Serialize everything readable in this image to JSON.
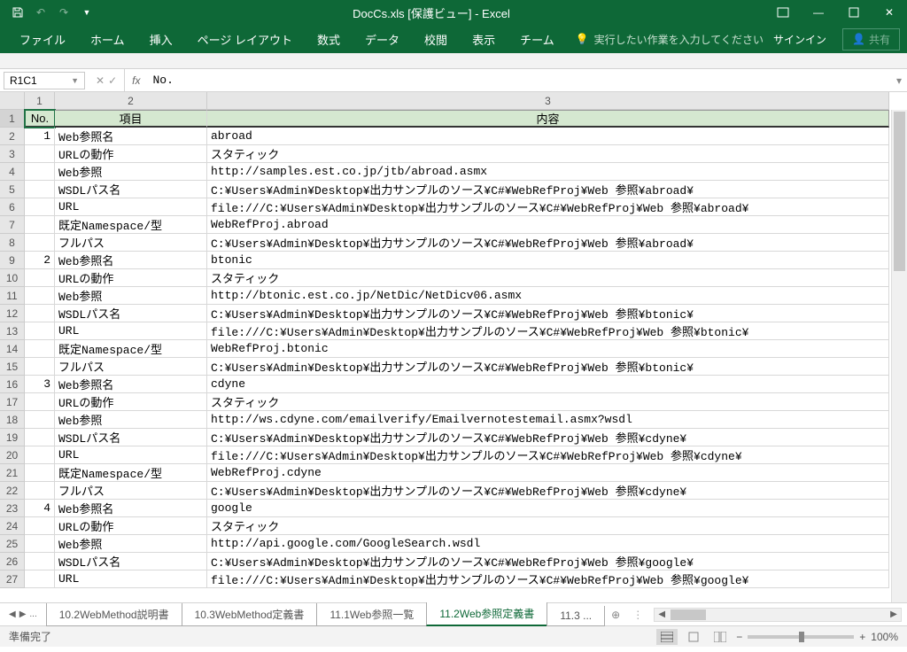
{
  "titlebar": {
    "title": "DocCs.xls [保護ビュー] - Excel"
  },
  "ribbon": {
    "tabs": [
      "ファイル",
      "ホーム",
      "挿入",
      "ページ レイアウト",
      "数式",
      "データ",
      "校閲",
      "表示",
      "チーム"
    ],
    "tellme": "実行したい作業を入力してください",
    "signin": "サインイン",
    "share": "共有"
  },
  "formula": {
    "namebox": "R1C1",
    "fx": "fx",
    "value": "No."
  },
  "cols": [
    "1",
    "2",
    "3"
  ],
  "headers": {
    "c1": "No.",
    "c2": "項目",
    "c3": "内容"
  },
  "rows": [
    {
      "n": "2",
      "no": "1",
      "item": "Web参照名",
      "val": "abroad"
    },
    {
      "n": "3",
      "no": "",
      "item": "URLの動作",
      "val": "スタティック"
    },
    {
      "n": "4",
      "no": "",
      "item": "Web参照",
      "val": "http://samples.est.co.jp/jtb/abroad.asmx"
    },
    {
      "n": "5",
      "no": "",
      "item": "WSDLパス名",
      "val": "C:¥Users¥Admin¥Desktop¥出力サンプルのソース¥C#¥WebRefProj¥Web 参照¥abroad¥"
    },
    {
      "n": "6",
      "no": "",
      "item": "URL",
      "val": "file:///C:¥Users¥Admin¥Desktop¥出力サンプルのソース¥C#¥WebRefProj¥Web 参照¥abroad¥"
    },
    {
      "n": "7",
      "no": "",
      "item": "既定Namespace/型",
      "val": "WebRefProj.abroad"
    },
    {
      "n": "8",
      "no": "",
      "item": "フルパス",
      "val": "C:¥Users¥Admin¥Desktop¥出力サンプルのソース¥C#¥WebRefProj¥Web 参照¥abroad¥"
    },
    {
      "n": "9",
      "no": "2",
      "item": "Web参照名",
      "val": "btonic"
    },
    {
      "n": "10",
      "no": "",
      "item": "URLの動作",
      "val": "スタティック"
    },
    {
      "n": "11",
      "no": "",
      "item": "Web参照",
      "val": "http://btonic.est.co.jp/NetDic/NetDicv06.asmx"
    },
    {
      "n": "12",
      "no": "",
      "item": "WSDLパス名",
      "val": "C:¥Users¥Admin¥Desktop¥出力サンプルのソース¥C#¥WebRefProj¥Web 参照¥btonic¥"
    },
    {
      "n": "13",
      "no": "",
      "item": "URL",
      "val": "file:///C:¥Users¥Admin¥Desktop¥出力サンプルのソース¥C#¥WebRefProj¥Web 参照¥btonic¥"
    },
    {
      "n": "14",
      "no": "",
      "item": "既定Namespace/型",
      "val": "WebRefProj.btonic"
    },
    {
      "n": "15",
      "no": "",
      "item": "フルパス",
      "val": "C:¥Users¥Admin¥Desktop¥出力サンプルのソース¥C#¥WebRefProj¥Web 参照¥btonic¥"
    },
    {
      "n": "16",
      "no": "3",
      "item": "Web参照名",
      "val": "cdyne"
    },
    {
      "n": "17",
      "no": "",
      "item": "URLの動作",
      "val": "スタティック"
    },
    {
      "n": "18",
      "no": "",
      "item": "Web参照",
      "val": "http://ws.cdyne.com/emailverify/Emailvernotestemail.asmx?wsdl"
    },
    {
      "n": "19",
      "no": "",
      "item": "WSDLパス名",
      "val": "C:¥Users¥Admin¥Desktop¥出力サンプルのソース¥C#¥WebRefProj¥Web 参照¥cdyne¥"
    },
    {
      "n": "20",
      "no": "",
      "item": "URL",
      "val": "file:///C:¥Users¥Admin¥Desktop¥出力サンプルのソース¥C#¥WebRefProj¥Web 参照¥cdyne¥"
    },
    {
      "n": "21",
      "no": "",
      "item": "既定Namespace/型",
      "val": "WebRefProj.cdyne"
    },
    {
      "n": "22",
      "no": "",
      "item": "フルパス",
      "val": "C:¥Users¥Admin¥Desktop¥出力サンプルのソース¥C#¥WebRefProj¥Web 参照¥cdyne¥"
    },
    {
      "n": "23",
      "no": "4",
      "item": "Web参照名",
      "val": "google"
    },
    {
      "n": "24",
      "no": "",
      "item": "URLの動作",
      "val": "スタティック"
    },
    {
      "n": "25",
      "no": "",
      "item": "Web参照",
      "val": "http://api.google.com/GoogleSearch.wsdl"
    },
    {
      "n": "26",
      "no": "",
      "item": "WSDLパス名",
      "val": "C:¥Users¥Admin¥Desktop¥出力サンプルのソース¥C#¥WebRefProj¥Web 参照¥google¥"
    },
    {
      "n": "27",
      "no": "",
      "item": "URL",
      "val": "file:///C:¥Users¥Admin¥Desktop¥出力サンプルのソース¥C#¥WebRefProj¥Web 参照¥google¥"
    }
  ],
  "sheettabs": {
    "ellipsis": "...",
    "tabs": [
      "10.2WebMethod説明書",
      "10.3WebMethod定義書",
      "11.1Web参照一覧",
      "11.2Web参照定義書",
      "11.3 ..."
    ],
    "active": 3
  },
  "status": {
    "ready": "準備完了",
    "zoom": "100%"
  }
}
